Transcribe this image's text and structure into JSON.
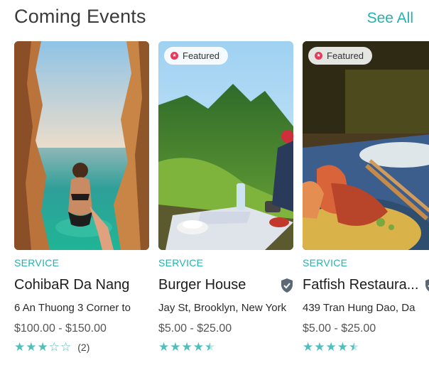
{
  "header": {
    "title": "Coming Events",
    "see_all_label": "See All"
  },
  "colors": {
    "accent": "#26b1ae",
    "badge_icon": "#e73a5b",
    "star": "#4fbfbd"
  },
  "events": [
    {
      "category": "SERVICE",
      "name": "CohibaR Da Nang",
      "address": "6 An Thuong 3 Corner to",
      "price": "$100.00 - $150.00",
      "rating": 3,
      "rating_max": 5,
      "review_count": "(2)",
      "featured": false,
      "verified": false,
      "image": "sea-cave-swimmer"
    },
    {
      "category": "SERVICE",
      "name": "Burger House",
      "address": "Jay St, Brooklyn, New York",
      "price": "$5.00 - $25.00",
      "rating": 4.5,
      "rating_max": 5,
      "featured": true,
      "featured_label": "Featured",
      "verified": true,
      "image": "mountain-picnic"
    },
    {
      "category": "SERVICE",
      "name": "Fatfish Restaura...",
      "address": "439 Tran Hung Dao, Da",
      "price": "$5.00 - $25.00",
      "rating": 4.5,
      "rating_max": 5,
      "featured": true,
      "featured_label": "Featured",
      "verified": true,
      "image": "seafood-dish"
    }
  ]
}
